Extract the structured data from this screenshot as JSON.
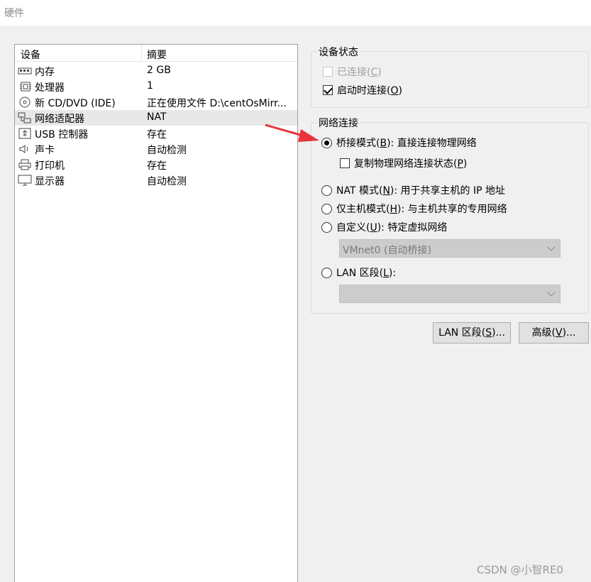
{
  "window": {
    "title": "硬件"
  },
  "device_list": {
    "headers": {
      "device": "设备",
      "summary": "摘要"
    },
    "items": [
      {
        "name": "内存",
        "summary": "2 GB",
        "icon": "memory-icon"
      },
      {
        "name": "处理器",
        "summary": "1",
        "icon": "processor-icon"
      },
      {
        "name": "新 CD/DVD (IDE)",
        "summary": "正在使用文件 D:\\centOsMirr...",
        "icon": "cd-dvd-icon"
      },
      {
        "name": "网络适配器",
        "summary": "NAT",
        "icon": "network-adapter-icon"
      },
      {
        "name": "USB 控制器",
        "summary": "存在",
        "icon": "usb-icon"
      },
      {
        "name": "声卡",
        "summary": "自动检测",
        "icon": "speaker-icon"
      },
      {
        "name": "打印机",
        "summary": "存在",
        "icon": "printer-icon"
      },
      {
        "name": "显示器",
        "summary": "自动检测",
        "icon": "monitor-icon"
      }
    ]
  },
  "device_status": {
    "title": "设备状态",
    "connected": {
      "text": "已连接(",
      "key": "C",
      "end": ")"
    },
    "connect_on_power": {
      "text": "启动时连接(",
      "key": "O",
      "end": ")"
    }
  },
  "network_connection": {
    "title": "网络连接",
    "bridged": {
      "text": "桥接模式(",
      "key": "B",
      "end": "): 直接连接物理网络"
    },
    "replicate": {
      "text": "复制物理网络连接状态(",
      "key": "P",
      "end": ")"
    },
    "nat": {
      "text": "NAT 模式(",
      "key": "N",
      "end": "): 用于共享主机的 IP 地址"
    },
    "host_only": {
      "text": "仅主机模式(",
      "key": "H",
      "end": "): 与主机共享的专用网络"
    },
    "custom": {
      "text": "自定义(",
      "key": "U",
      "end": "): 特定虚拟网络"
    },
    "custom_select": "VMnet0 (自动桥接)",
    "lan_segment": {
      "text": "LAN 区段(",
      "key": "L",
      "end": "):"
    },
    "lan_select": ""
  },
  "buttons": {
    "lan_segments": {
      "text": "LAN 区段(",
      "key": "S",
      "end": ")..."
    },
    "advanced": {
      "text": "高级(",
      "key": "V",
      "end": ")..."
    }
  },
  "watermark": "CSDN @小智RE0",
  "colors": {
    "arrow": "#e8343a",
    "selected_row": "#e8e8e8"
  }
}
